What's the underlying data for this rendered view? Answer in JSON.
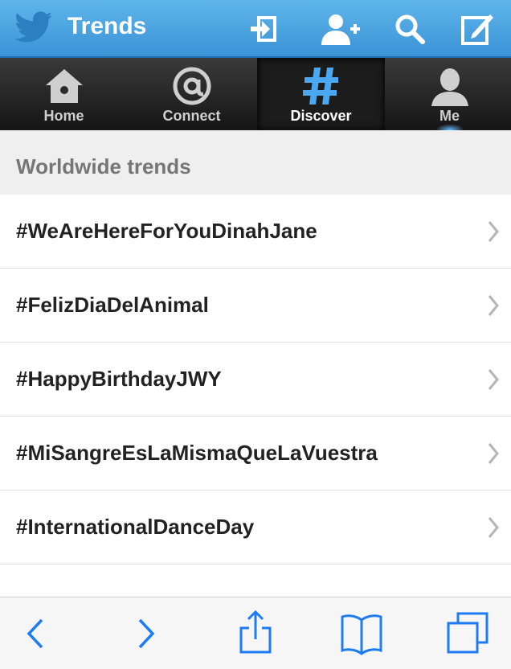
{
  "header": {
    "title": "Trends"
  },
  "header_icons": [
    "sign-in-icon",
    "add-user-icon",
    "search-icon",
    "compose-icon"
  ],
  "tabs": [
    {
      "label": "Home",
      "icon": "home-icon"
    },
    {
      "label": "Connect",
      "icon": "at-icon"
    },
    {
      "label": "Discover",
      "icon": "hashtag-icon",
      "active": true
    },
    {
      "label": "Me",
      "icon": "person-icon"
    }
  ],
  "section": {
    "title": "Worldwide trends"
  },
  "trends": [
    {
      "label": "#WeAreHereForYouDinahJane"
    },
    {
      "label": "#FelizDiaDelAnimal"
    },
    {
      "label": "#HappyBirthdayJWY"
    },
    {
      "label": "#MiSangreEsLaMismaQueLaVuestra"
    },
    {
      "label": "#InternationalDanceDay"
    }
  ],
  "toolbar_icons": [
    "back-icon",
    "forward-icon",
    "share-icon",
    "bookmarks-icon",
    "tabs-icon"
  ],
  "colors": {
    "header_blue": "#3b92d6",
    "active_hashtag": "#4aa7f0",
    "text_dark": "#222222",
    "toolbar_blue": "#1e7cf2"
  }
}
